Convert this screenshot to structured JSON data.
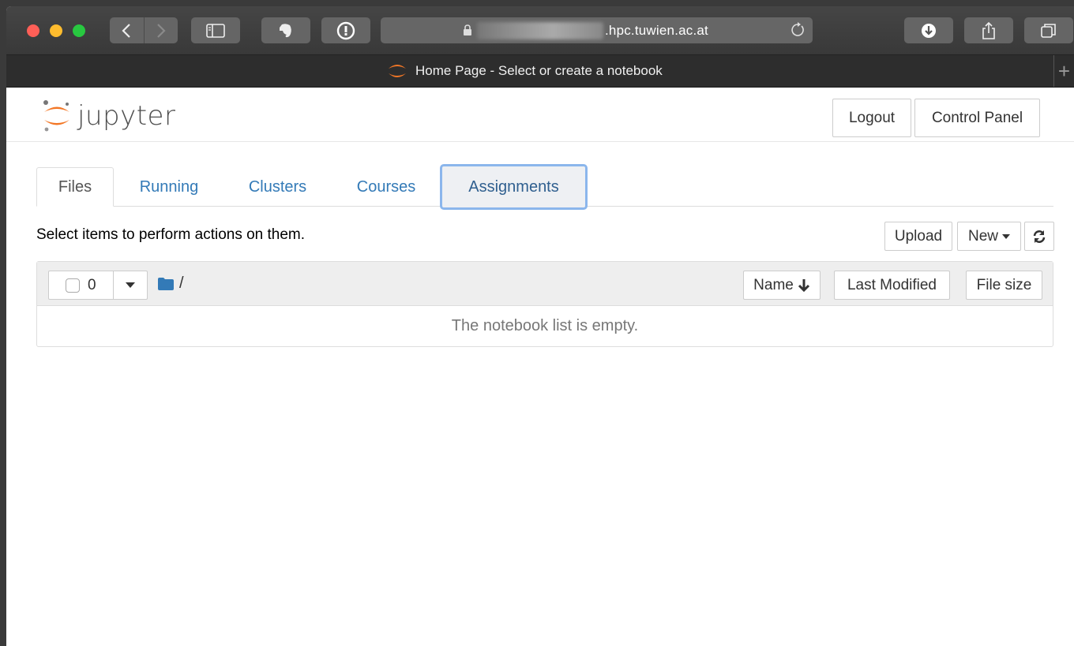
{
  "browser": {
    "address_url": ".hpc.tuwien.ac.at",
    "tab_title": "Home Page - Select or create a notebook",
    "new_tab": "+"
  },
  "header": {
    "logo_text": "jupyter",
    "logout_label": "Logout",
    "control_panel_label": "Control Panel"
  },
  "tabs": [
    {
      "label": "Files",
      "active": true
    },
    {
      "label": "Running"
    },
    {
      "label": "Clusters"
    },
    {
      "label": "Courses"
    },
    {
      "label": "Assignments",
      "focused": true
    }
  ],
  "toolbar": {
    "hint": "Select items to perform actions on them.",
    "upload_label": "Upload",
    "new_label": "New"
  },
  "list": {
    "selected_count": "0",
    "path": "/",
    "sort_name": "Name",
    "sort_last_modified": "Last Modified",
    "sort_file_size": "File size",
    "empty_message": "The notebook list is empty."
  },
  "colors": {
    "link": "#337ab7",
    "jupyter_orange": "#f37726",
    "focus_ring": "#8bb6ec"
  }
}
